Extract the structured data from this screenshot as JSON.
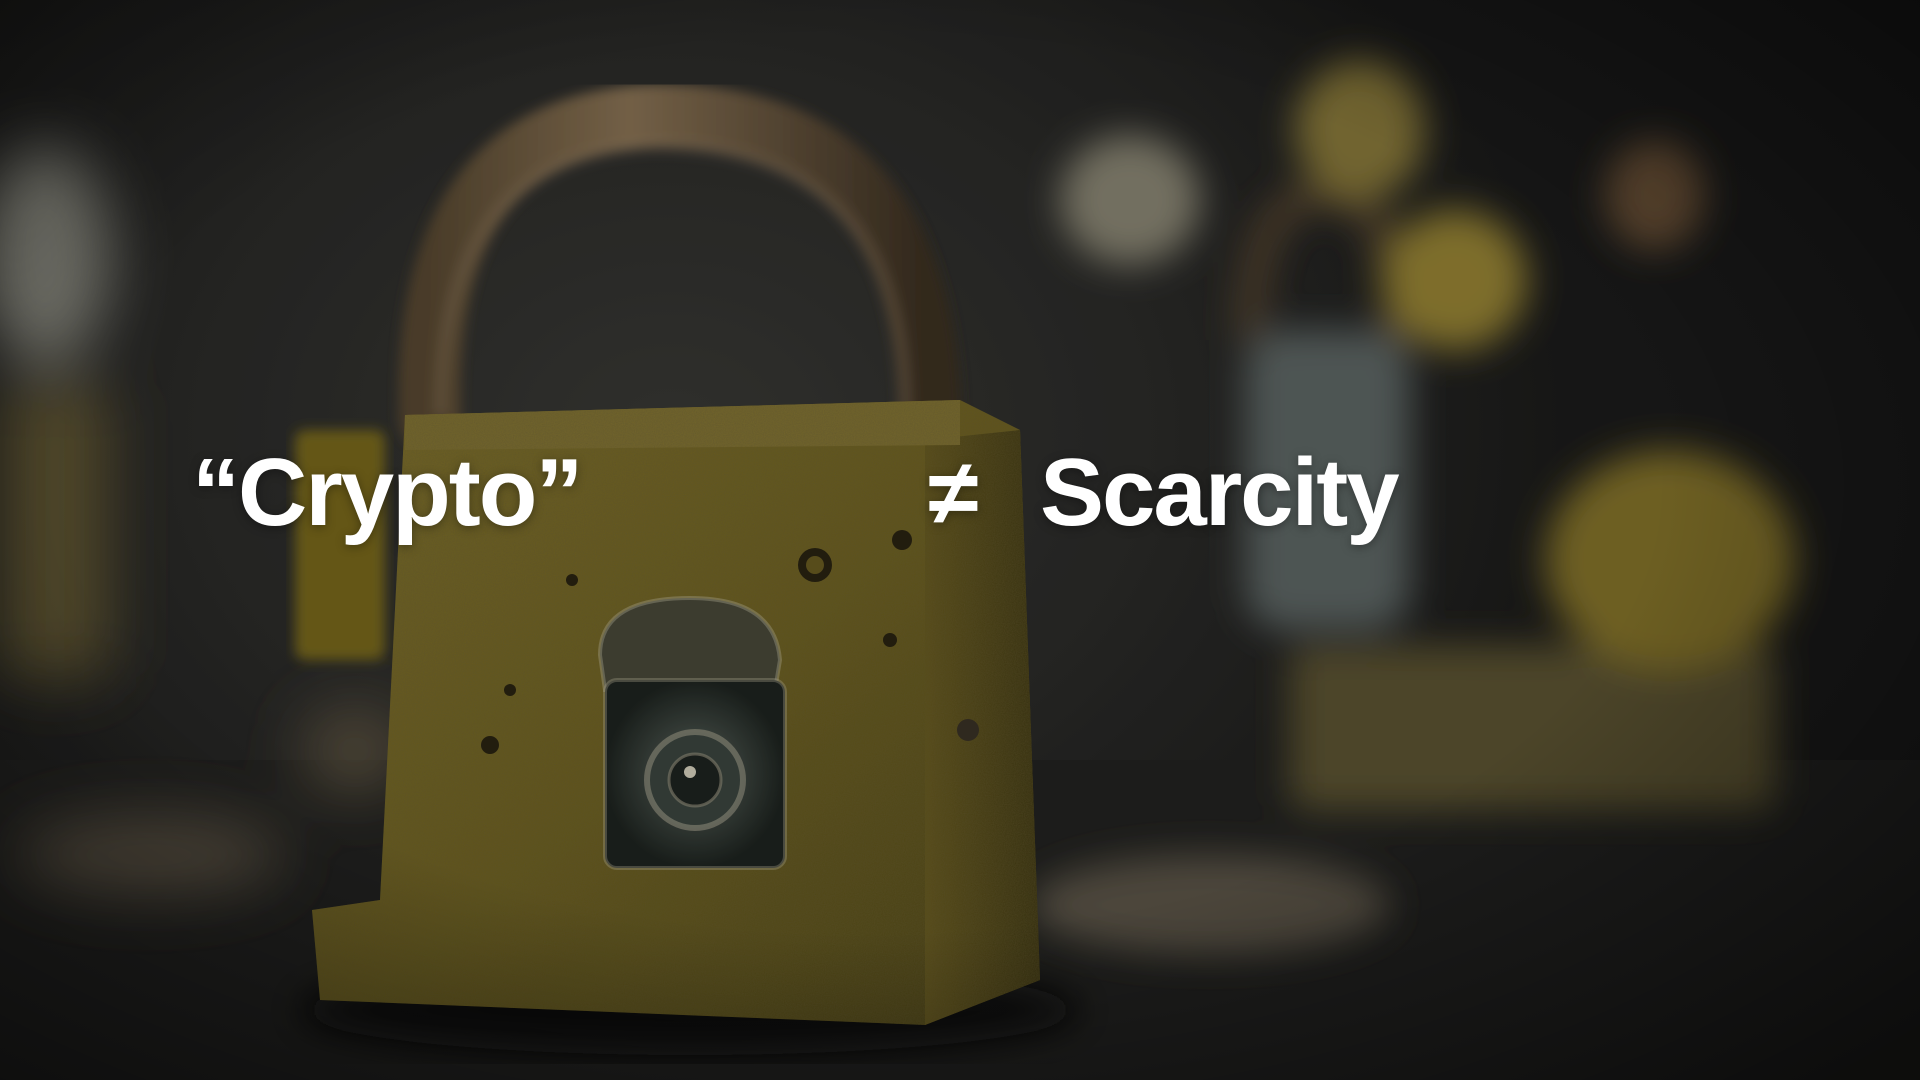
{
  "slide": {
    "left_text": "“Crypto”",
    "operator": "≠",
    "right_text": "Scarcity",
    "text_color": "#ffffff",
    "background_photo": "antique-padlocks"
  }
}
